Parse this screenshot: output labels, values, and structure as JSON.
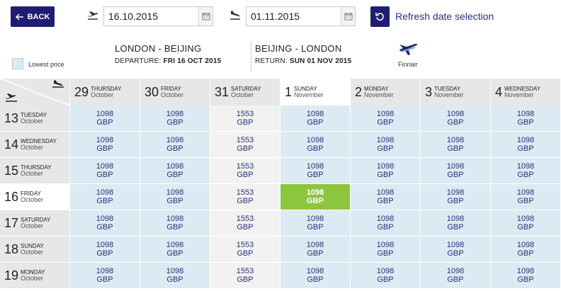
{
  "toolbar": {
    "back_label": "BACK",
    "departure_date": "16.10.2015",
    "return_date": "01.11.2015",
    "refresh_label": "Refresh date selection"
  },
  "legend": {
    "lowest_price_label": "Lowest price"
  },
  "outbound": {
    "cities": "LONDON - BEIJING",
    "label": "DEPARTURE:",
    "date": "FRI 16 OCT 2015"
  },
  "inbound": {
    "cities": "BEIJING - LONDON",
    "label": "RETURN:",
    "date": "SUN 01 NOV 2015"
  },
  "airline": {
    "name": "Finnair",
    "icon": "finnair-logo"
  },
  "colors": {
    "primary": "#1f1d73",
    "cell": "#dceaf3",
    "cell_highlight": "#f2f2f2",
    "selected": "#8cc63f",
    "header_bg": "#e7e7e7"
  },
  "return_columns": [
    {
      "num": "29",
      "dow": "THURSDAY",
      "month": "October"
    },
    {
      "num": "30",
      "dow": "FRIDAY",
      "month": "October"
    },
    {
      "num": "31",
      "dow": "SATURDAY",
      "month": "October"
    },
    {
      "num": "1",
      "dow": "SUNDAY",
      "month": "November",
      "selected": true
    },
    {
      "num": "2",
      "dow": "MONDAY",
      "month": "November"
    },
    {
      "num": "3",
      "dow": "TUESDAY",
      "month": "November"
    },
    {
      "num": "4",
      "dow": "WEDNESDAY",
      "month": "November"
    }
  ],
  "departure_rows": [
    {
      "num": "13",
      "dow": "TUESDAY",
      "month": "October",
      "prices": [
        "1098",
        "1098",
        "1553",
        "1098",
        "1098",
        "1098",
        "1098"
      ]
    },
    {
      "num": "14",
      "dow": "WEDNESDAY",
      "month": "October",
      "prices": [
        "1098",
        "1098",
        "1553",
        "1098",
        "1098",
        "1098",
        "1098"
      ]
    },
    {
      "num": "15",
      "dow": "THURSDAY",
      "month": "October",
      "prices": [
        "1098",
        "1098",
        "1553",
        "1098",
        "1098",
        "1098",
        "1098"
      ]
    },
    {
      "num": "16",
      "dow": "FRIDAY",
      "month": "October",
      "selected": true,
      "prices": [
        "1098",
        "1098",
        "1553",
        "1098",
        "1098",
        "1098",
        "1098"
      ]
    },
    {
      "num": "17",
      "dow": "SATURDAY",
      "month": "October",
      "prices": [
        "1098",
        "1098",
        "1553",
        "1098",
        "1098",
        "1098",
        "1098"
      ]
    },
    {
      "num": "18",
      "dow": "SUNDAY",
      "month": "October",
      "prices": [
        "1098",
        "1098",
        "1553",
        "1098",
        "1098",
        "1098",
        "1098"
      ]
    },
    {
      "num": "19",
      "dow": "MONDAY",
      "month": "October",
      "prices": [
        "1098",
        "1098",
        "1553",
        "1098",
        "1098",
        "1098",
        "1098"
      ]
    }
  ],
  "currency": "GBP",
  "highlight_column": 2,
  "selected_cell": {
    "row": 3,
    "col": 3
  }
}
